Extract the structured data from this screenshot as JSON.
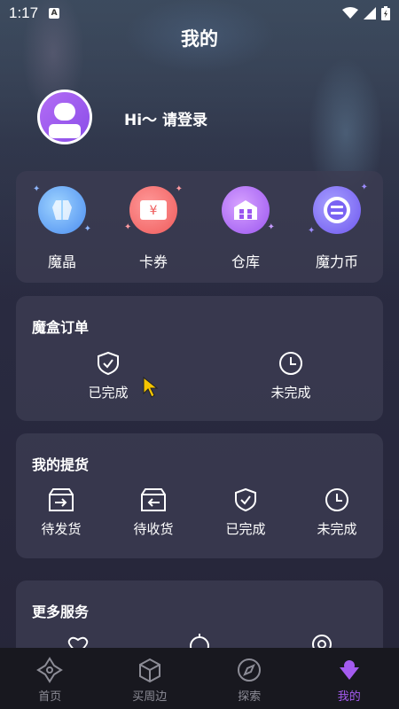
{
  "status_bar": {
    "time": "1:17",
    "notif": "A"
  },
  "header": {
    "title": "我的"
  },
  "user": {
    "login_prompt": "Hi～ 请登录"
  },
  "assets": [
    {
      "label": "魔晶",
      "icon": "crystal-icon"
    },
    {
      "label": "卡券",
      "icon": "coupon-icon",
      "symbol": "¥"
    },
    {
      "label": "仓库",
      "icon": "warehouse-icon"
    },
    {
      "label": "魔力币",
      "icon": "coin-icon"
    }
  ],
  "box_orders": {
    "title": "魔盒订单",
    "items": [
      {
        "label": "已完成",
        "icon": "shield-check-icon"
      },
      {
        "label": "未完成",
        "icon": "clock-icon"
      }
    ]
  },
  "pickup": {
    "title": "我的提货",
    "items": [
      {
        "label": "待发货",
        "icon": "box-send-icon"
      },
      {
        "label": "待收货",
        "icon": "box-receive-icon"
      },
      {
        "label": "已完成",
        "icon": "shield-check-icon"
      },
      {
        "label": "未完成",
        "icon": "clock-icon"
      }
    ]
  },
  "more": {
    "title": "更多服务"
  },
  "tabs": [
    {
      "label": "首页",
      "icon": "home-icon",
      "active": false
    },
    {
      "label": "买周边",
      "icon": "cube-icon",
      "active": false
    },
    {
      "label": "探索",
      "icon": "compass-icon",
      "active": false
    },
    {
      "label": "我的",
      "icon": "profile-icon",
      "active": true
    }
  ],
  "colors": {
    "accent": "#a45bf0",
    "card": "#3c3c52",
    "tabbar": "#18181f"
  }
}
